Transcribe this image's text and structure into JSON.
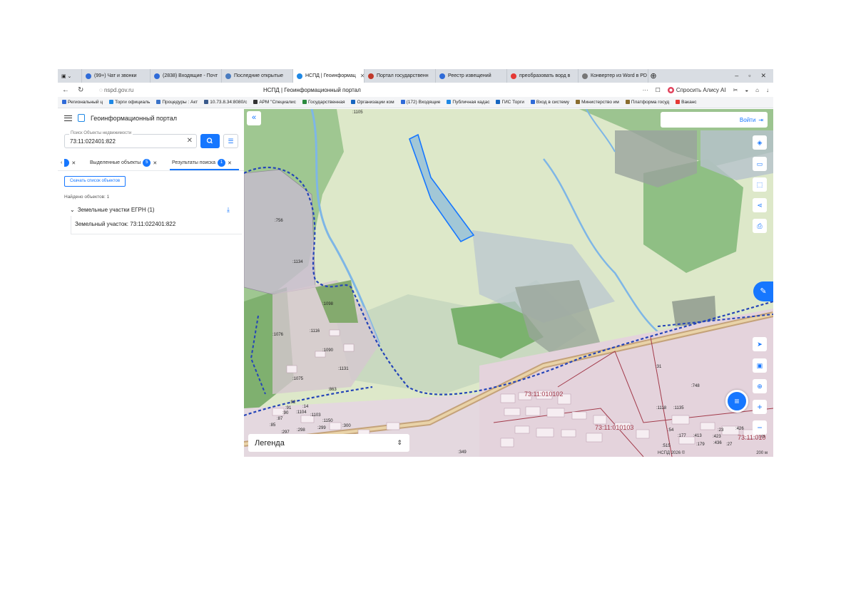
{
  "browser": {
    "tabs": [
      {
        "label": "(99+) Чат и звонки",
        "color": "#2f6bd8"
      },
      {
        "label": "(2838) Входящие - Почт",
        "color": "#2f6bd8"
      },
      {
        "label": "Последние открытые",
        "color": "#4a7cc0"
      },
      {
        "label": "НСПД | Геоинформац",
        "color": "#1e88e5",
        "active": true
      },
      {
        "label": "Портал государственн",
        "color": "#c0392b"
      },
      {
        "label": "Реестр извещений",
        "color": "#2f6bd8"
      },
      {
        "label": "преобразовать ворд в",
        "color": "#e53935"
      },
      {
        "label": "Конвертер из Word в PD",
        "color": "#777777"
      }
    ],
    "window_controls": [
      "–",
      "▫",
      "✕"
    ],
    "url": "nspd.gov.ru",
    "page_title": "НСПД | Геоинформационный портал",
    "alice_label": "Спросить Алису AI",
    "bookmarks": [
      "Региональный ц",
      "Торги официаль",
      "Процедуры : Акт",
      "10.73.8.34:8080/c",
      "АРМ \"Специалис",
      "Государственная",
      "Организации ком",
      "(172) Входящие",
      "Публичная кадас",
      "ГИС Торги",
      "Вход в систему",
      "Министерство им",
      "Платформа госуд",
      "Ваканс"
    ]
  },
  "sidebar": {
    "title": "Геоинформационный портал",
    "search_label": "Поиск Объекты недвижимости",
    "search_value": "73:11:022401:822",
    "tab_selected": "Выделенные объекты",
    "tab_selected_count": "5",
    "tab_results": "Результаты поиска",
    "tab_results_count": "1",
    "download_button": "Скачать список объектов",
    "found_text": "Найдено объектов: 1",
    "group_title": "Земельные участки ЕГРН (1)",
    "item_text": "Земельный участок: 73:11:022401:822"
  },
  "map": {
    "login_label": "Войти",
    "legend_label": "Легенда",
    "copyright": "НСПД 2026 ©",
    "scale": "200 м",
    "quarter_labels": [
      "73:11:010102",
      "73:11:010103",
      "73:11:010"
    ],
    "parcel_labels": [
      ":1105",
      ":756",
      ":1134",
      ":1098",
      ":1076",
      ":1116",
      ":1090",
      ":1131",
      ":1075",
      ":863",
      ":92",
      ":91",
      ":90",
      ":14",
      ":1104",
      ":1103",
      ":87",
      ":85",
      ":297",
      ":298",
      ":299",
      ":1150",
      ":300",
      ":349",
      ":748",
      ":31",
      ":1118",
      ":1135",
      ":54",
      ":23",
      ":426",
      ":177",
      ":413",
      ":423",
      ":179",
      ":436",
      ":27",
      ":515",
      ":73"
    ]
  }
}
